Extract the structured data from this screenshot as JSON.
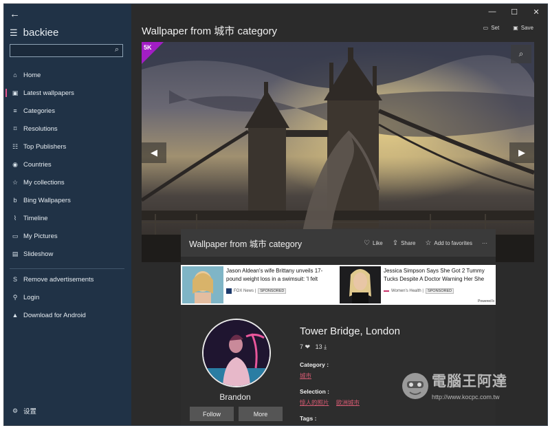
{
  "app": {
    "name": "backiee"
  },
  "search": {
    "placeholder": ""
  },
  "sidebar": {
    "items": [
      {
        "label": "Home",
        "icon": "home-icon",
        "glyph": "⌂"
      },
      {
        "label": "Latest wallpapers",
        "icon": "latest-icon",
        "glyph": "▣",
        "active": true
      },
      {
        "label": "Categories",
        "icon": "list-icon",
        "glyph": "≡"
      },
      {
        "label": "Resolutions",
        "icon": "resolution-icon",
        "glyph": "⌑"
      },
      {
        "label": "Top Publishers",
        "icon": "publishers-icon",
        "glyph": "☷"
      },
      {
        "label": "Countries",
        "icon": "globe-icon",
        "glyph": "◉"
      },
      {
        "label": "My collections",
        "icon": "star-icon",
        "glyph": "☆"
      },
      {
        "label": "Bing Wallpapers",
        "icon": "bing-icon",
        "glyph": "b"
      },
      {
        "label": "Timeline",
        "icon": "timeline-icon",
        "glyph": "⌇"
      },
      {
        "label": "My Pictures",
        "icon": "pictures-icon",
        "glyph": "▭"
      },
      {
        "label": "Slideshow",
        "icon": "slideshow-icon",
        "glyph": "▤"
      }
    ],
    "extra": [
      {
        "label": "Remove advertisements",
        "icon": "remove-ads-icon",
        "glyph": "S"
      },
      {
        "label": "Login",
        "icon": "user-icon",
        "glyph": "⚲"
      },
      {
        "label": "Download for Android",
        "icon": "android-icon",
        "glyph": "▲"
      }
    ],
    "settings_label": "设置"
  },
  "header": {
    "title": "Wallpaper from 城市 category",
    "set_label": "Set",
    "save_label": "Save"
  },
  "hero": {
    "badge": "5K"
  },
  "panel": {
    "title": "Wallpaper from 城市 category",
    "like_label": "Like",
    "share_label": "Share",
    "favorites_label": "Add to favorites",
    "more_label": "···"
  },
  "ads": [
    {
      "headline": "Jason Aldean's wife Brittany unveils 17-pound weight loss in a swimsuit: 'I felt",
      "source": "FOX News |",
      "sponsored": "SPONSORED"
    },
    {
      "headline": "Jessica Simpson Says She Got 2 Tummy Tucks Despite A Doctor Warning Her She",
      "source": "Women's Health |",
      "sponsored": "SPONSORED"
    }
  ],
  "ads_powered": "Powered b",
  "publisher": {
    "name": "Brandon",
    "follow_label": "Follow",
    "more_label": "More"
  },
  "wallpaper": {
    "title": "Tower Bridge, London",
    "likes": "7",
    "downloads": "13",
    "category_label": "Category :",
    "category_value": "城市",
    "selection_label": "Selection :",
    "selection_values": [
      "惊人的照片",
      "欧洲城市"
    ],
    "tags_label": "Tags :"
  },
  "watermark": {
    "text": "電腦王阿達",
    "url": "http://www.kocpc.com.tw"
  },
  "colors": {
    "sidebar": "#203246",
    "main": "#2b2b2b",
    "accent": "#d85b73",
    "badge": "#a21ec4"
  }
}
